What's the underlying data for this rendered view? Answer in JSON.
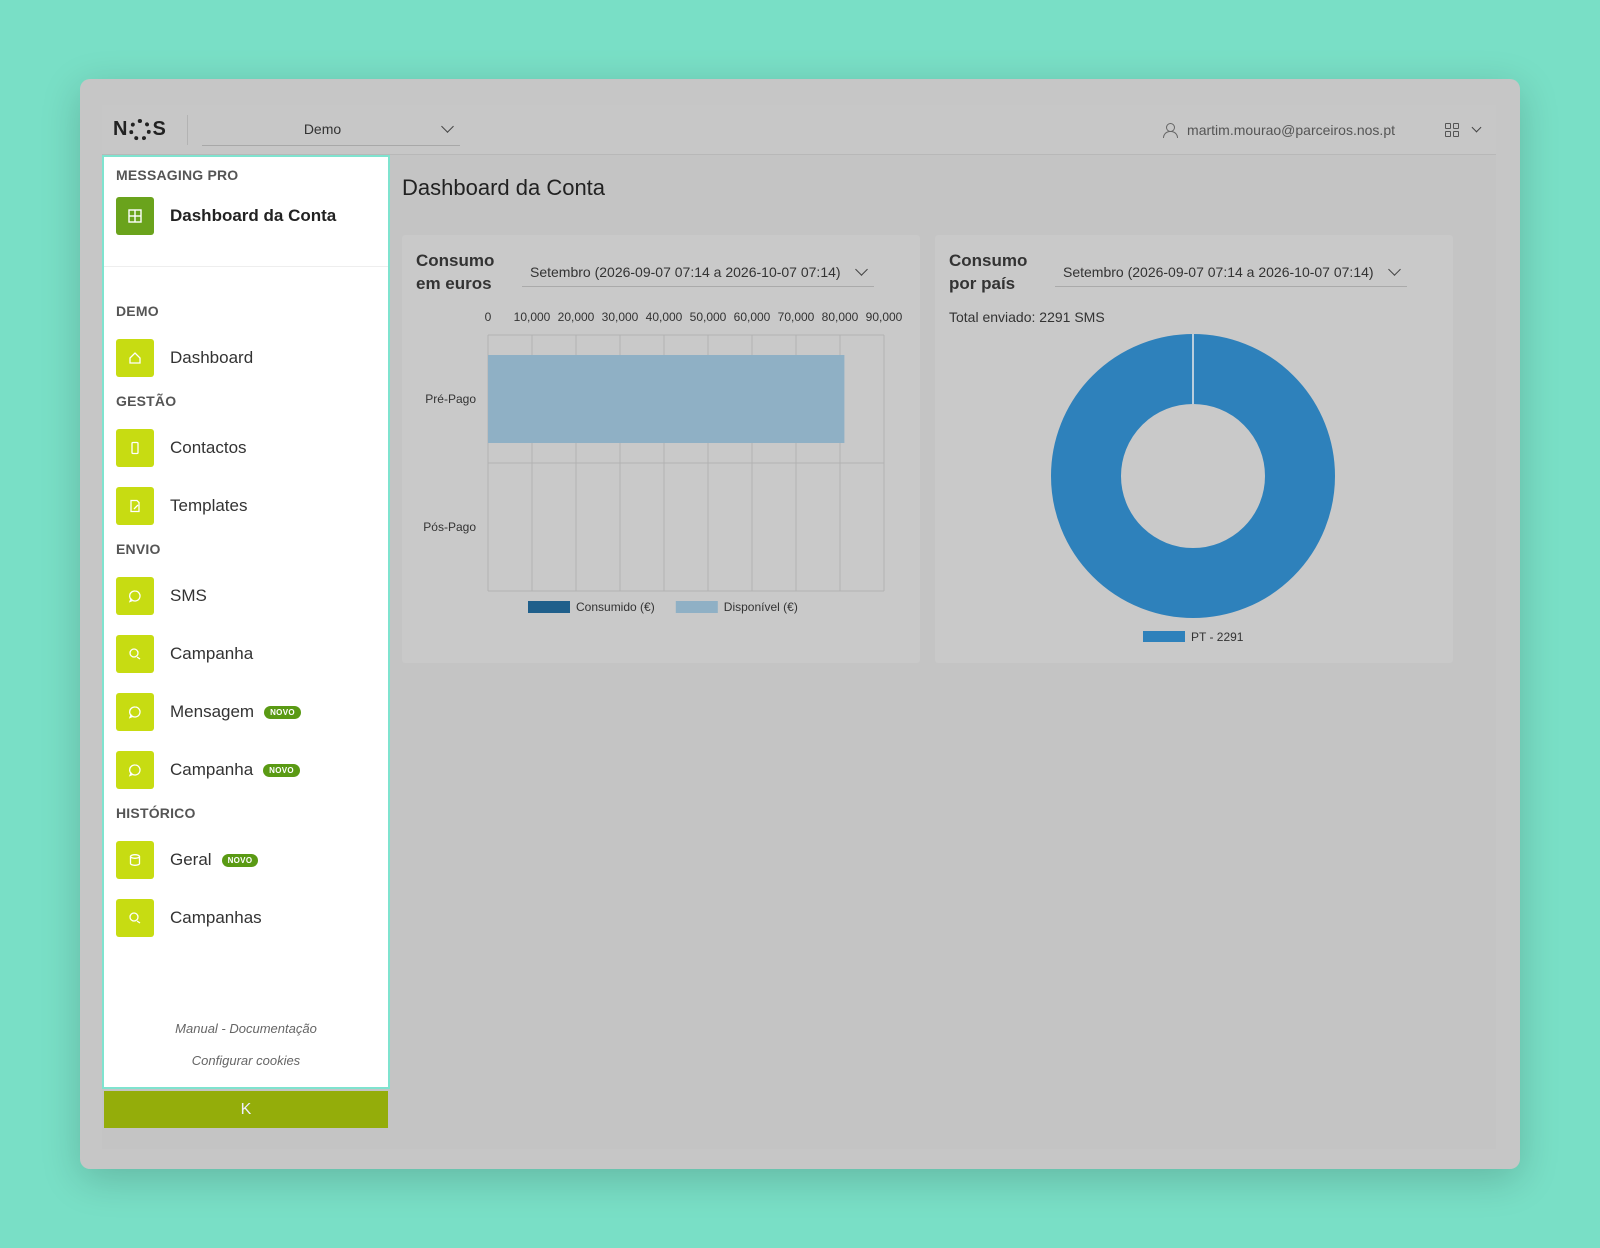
{
  "header": {
    "logo": "NOS",
    "account": "Demo",
    "user_email": "martim.mourao@parceiros.nos.pt"
  },
  "sidebar": {
    "product": "MESSAGING PRO",
    "dashboard_conta": "Dashboard da Conta",
    "sections": {
      "demo": "DEMO",
      "gestao": "GESTÃO",
      "envio": "ENVIO",
      "historico": "HISTÓRICO"
    },
    "items": {
      "dashboard": "Dashboard",
      "contactos": "Contactos",
      "templates": "Templates",
      "sms": "SMS",
      "campanha": "Campanha",
      "mensagem": "Mensagem",
      "campanha_novo": "Campanha",
      "geral": "Geral",
      "campanhas": "Campanhas"
    },
    "badge": "NOVO",
    "footer": {
      "manual": "Manual - Documentação",
      "cookies": "Configurar cookies"
    },
    "collapse_label": "K"
  },
  "main": {
    "title": "Dashboard da Conta",
    "card1": {
      "title": "Consumo em euros",
      "period": "Setembro (2026-09-07 07:14 a 2026-10-07 07:14)"
    },
    "card2": {
      "title": "Consumo por país",
      "period": "Setembro (2026-09-07 07:14 a 2026-10-07 07:14)",
      "total": "Total enviado: 2291 SMS"
    }
  },
  "chart_data": [
    {
      "type": "bar",
      "orientation": "horizontal",
      "stacked": true,
      "categories": [
        "Pré-Pago",
        "Pós-Pago"
      ],
      "series": [
        {
          "name": "Consumido (€)",
          "values": [
            0,
            0
          ],
          "color": "#1f5f8b"
        },
        {
          "name": "Disponível (€)",
          "values": [
            81000,
            0
          ],
          "color": "#8fb0c5"
        }
      ],
      "xlim": [
        0,
        90000
      ],
      "xticks": [
        "0",
        "10,000",
        "20,000",
        "30,000",
        "40,000",
        "50,000",
        "60,000",
        "70,000",
        "80,000",
        "90,000"
      ],
      "grid": true,
      "legend": "bottom"
    },
    {
      "type": "pie",
      "donut": true,
      "labels": [
        "PT - 2291"
      ],
      "values": [
        2291
      ],
      "colors": [
        "#2e81bb"
      ],
      "legend": "bottom"
    }
  ]
}
